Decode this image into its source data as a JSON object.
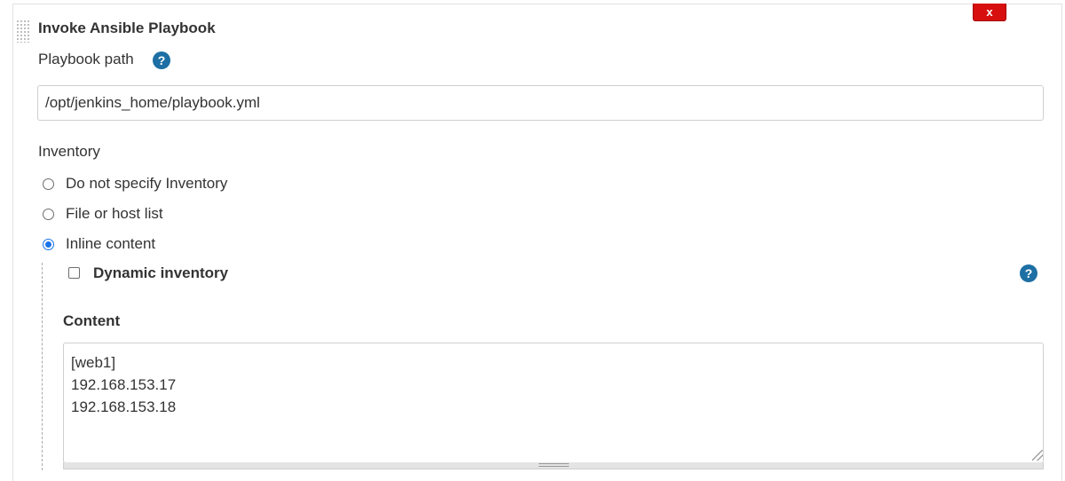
{
  "section": {
    "title": "Invoke Ansible Playbook",
    "delete_label": "x"
  },
  "playbook": {
    "label": "Playbook path",
    "help": "?",
    "value": "/opt/jenkins_home/playbook.yml"
  },
  "inventory": {
    "label": "Inventory",
    "options": [
      {
        "label": "Do not specify Inventory",
        "checked": false
      },
      {
        "label": "File or host list",
        "checked": false
      },
      {
        "label": "Inline content",
        "checked": true
      }
    ],
    "dynamic_label": "Dynamic inventory",
    "dynamic_checked": false,
    "dynamic_help": "?",
    "content_label": "Content",
    "content_value": "[web1]\n192.168.153.17\n192.168.153.18"
  }
}
